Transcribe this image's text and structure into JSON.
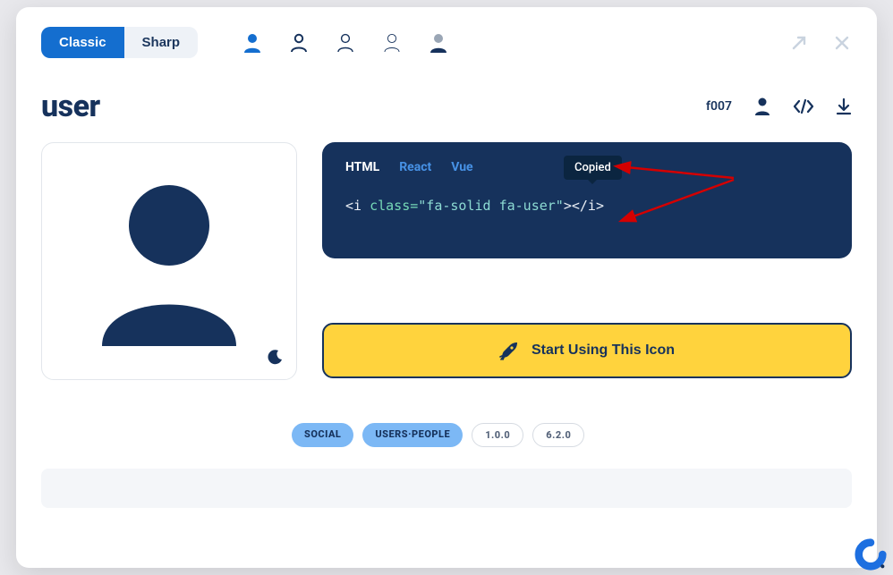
{
  "header": {
    "toggle": {
      "classic": "Classic",
      "sharp": "Sharp"
    },
    "style_variants": [
      "solid",
      "regular",
      "light",
      "thin",
      "duotone"
    ]
  },
  "title": {
    "name": "user",
    "unicode": "f007"
  },
  "code": {
    "tabs": {
      "html": "HTML",
      "react": "React",
      "vue": "Vue"
    },
    "snippet": {
      "open": "<i ",
      "attr": "class=",
      "value": "\"fa-solid fa-user\"",
      "mid": ">",
      "close": "</i>"
    },
    "copied_label": "Copied"
  },
  "cta": {
    "label": "Start Using This Icon"
  },
  "tags": {
    "social": "SOCIAL",
    "users_people": "USERS·PEOPLE",
    "v1": "1.0.0",
    "v6": "6.2.0"
  }
}
